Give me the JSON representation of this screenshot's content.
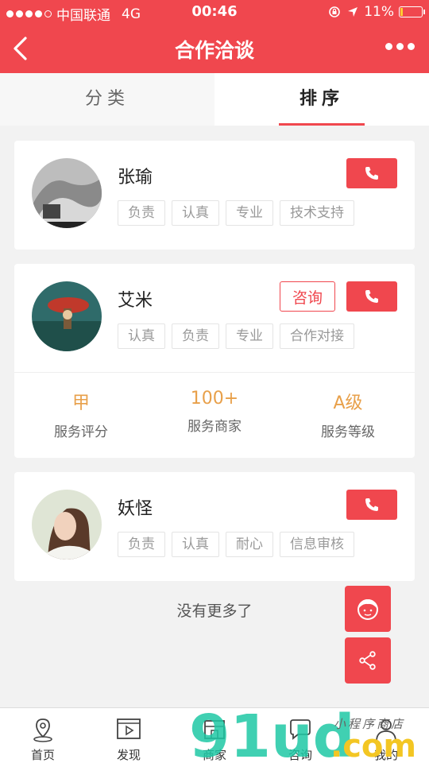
{
  "statusbar": {
    "carrier": "中国联通",
    "network": "4G",
    "time": "00:46",
    "battery": "11%",
    "battery_level": 0.11
  },
  "navbar": {
    "title": "合作洽谈",
    "back_icon": "chevron-left-icon",
    "more_icon": "more-icon"
  },
  "tabs": [
    {
      "label": "分类"
    },
    {
      "label": "排序",
      "active": true
    }
  ],
  "cards": [
    {
      "name": "张瑜",
      "tags": [
        "负责",
        "认真",
        "专业",
        "技术支持"
      ]
    },
    {
      "name": "艾米",
      "consult_label": "咨询",
      "tags": [
        "认真",
        "负责",
        "专业",
        "合作对接"
      ],
      "stats": [
        {
          "value": "甲",
          "label": "服务评分"
        },
        {
          "value": "100+",
          "label": "服务商家"
        },
        {
          "value": "A级",
          "label": "服务等级"
        }
      ]
    },
    {
      "name": "妖怪",
      "tags": [
        "负责",
        "认真",
        "耐心",
        "信息审核"
      ]
    }
  ],
  "no_more": "没有更多了",
  "bottom_nav": [
    {
      "label": "首页",
      "icon": "location-pin-icon"
    },
    {
      "label": "发现",
      "icon": "play-video-icon"
    },
    {
      "label": "商家",
      "icon": "store-icon"
    },
    {
      "label": "咨询",
      "icon": "chat-icon"
    },
    {
      "label": "我的",
      "icon": "user-icon"
    }
  ],
  "watermark": {
    "text": "91ud",
    "suffix": ".com",
    "caption": "小程序商店"
  },
  "colors": {
    "brand": "#f0474e",
    "stat_value": "#e8a04a"
  }
}
